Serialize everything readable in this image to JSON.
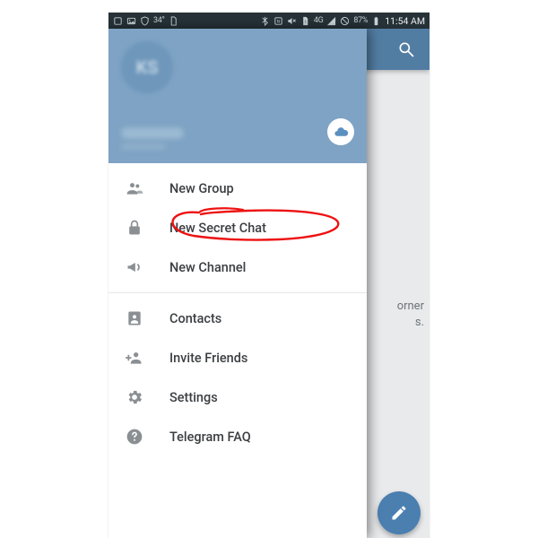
{
  "statusbar": {
    "temp": "34°",
    "net": "4G",
    "battery": "87%",
    "time": "11:54 AM"
  },
  "drawer": {
    "avatar_initials": "KS",
    "items_top": [
      {
        "icon": "group-icon",
        "label": "New Group"
      },
      {
        "icon": "lock-icon",
        "label": "New Secret Chat"
      },
      {
        "icon": "megaphone-icon",
        "label": "New Channel"
      }
    ],
    "items_bottom": [
      {
        "icon": "contacts-icon",
        "label": "Contacts"
      },
      {
        "icon": "invite-icon",
        "label": "Invite Friends"
      },
      {
        "icon": "settings-icon",
        "label": "Settings"
      },
      {
        "icon": "help-icon",
        "label": "Telegram FAQ"
      }
    ]
  },
  "background": {
    "hint_line1": "orner",
    "hint_line2": "s."
  }
}
